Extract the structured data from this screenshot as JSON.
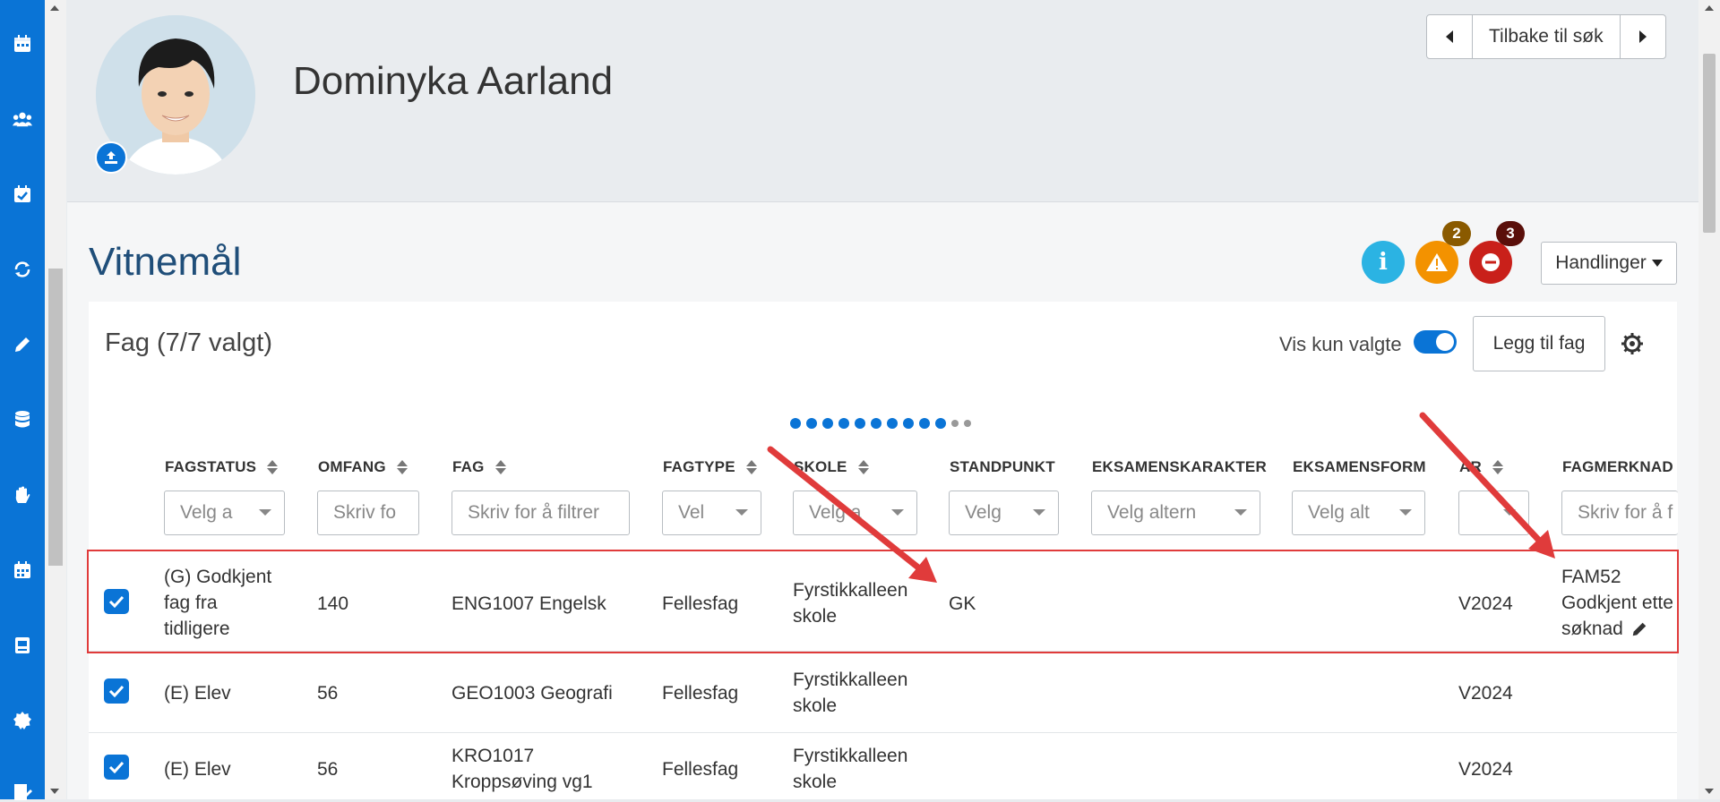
{
  "sidebar": {
    "icons": [
      "calendar-icon",
      "users-icon",
      "calendar-check-icon",
      "sync-icon",
      "pencil-icon",
      "database-icon",
      "hand-icon",
      "calendar-grid-icon",
      "book-icon",
      "badge-icon",
      "edit-doc-icon"
    ]
  },
  "header": {
    "student_name": "Dominyka Aarland",
    "back_to_search": "Tilbake til søk"
  },
  "section": {
    "title": "Vitnemål",
    "warning_count": "2",
    "error_count": "3",
    "actions_label": "Handlinger"
  },
  "card": {
    "title": "Fag (7/7 valgt)",
    "show_selected_label": "Vis kun valgte",
    "add_subject_label": "Legg til fag"
  },
  "table": {
    "columns": {
      "fagstatus": "FAGSTATUS",
      "omfang": "OMFANG",
      "fag": "FAG",
      "fagtype": "FAGTYPE",
      "skole": "SKOLE",
      "standpunkt": "STANDPUNKT",
      "eksamenskarakter": "EKSAMENSKARAKTER",
      "eksamensform": "EKSAMENSFORM",
      "ar": "ÅR",
      "fagmerknad": "FAGMERKNAD"
    },
    "filters": {
      "fagstatus": "Velg a",
      "omfang": "Skriv fo",
      "fag": "Skriv for å filtrer",
      "fagtype": "Vel",
      "skole": "Velg a",
      "standpunkt": "Velg",
      "eksamenskarakter": "Velg altern",
      "eksamensform": "Velg alt",
      "ar": "",
      "fagmerknad": "Skriv for å f"
    },
    "rows": [
      {
        "status_l1": "(G) Godkjent",
        "status_l2": "fag fra",
        "status_l3": "tidligere",
        "omfang": "140",
        "fag_l1": "ENG1007 Engelsk",
        "fag_l2": "",
        "fagtype": "Fellesfag",
        "skole_l1": "Fyrstikkalleen",
        "skole_l2": "skole",
        "standpunkt": "GK",
        "ar": "V2024",
        "merknad_l1": "FAM52",
        "merknad_l2": "Godkjent ette",
        "merknad_l3": "søknad"
      },
      {
        "status_l1": "(E) Elev",
        "omfang": "56",
        "fag_l1": "GEO1003 Geografi",
        "fag_l2": "",
        "fagtype": "Fellesfag",
        "skole_l1": "Fyrstikkalleen",
        "skole_l2": "skole",
        "standpunkt": "",
        "ar": "V2024"
      },
      {
        "status_l1": "(E) Elev",
        "omfang": "56",
        "fag_l1": "KRO1017",
        "fag_l2": "Kroppsøving vg1",
        "fagtype": "Fellesfag",
        "skole_l1": "Fyrstikkalleen",
        "skole_l2": "skole",
        "standpunkt": "",
        "ar": "V2024"
      }
    ]
  },
  "colors": {
    "primary": "#0a74d6",
    "info": "#2bb3e3",
    "warning": "#f39200",
    "danger": "#c9201a",
    "highlight": "#e03b3b",
    "title": "#1f4e79"
  }
}
